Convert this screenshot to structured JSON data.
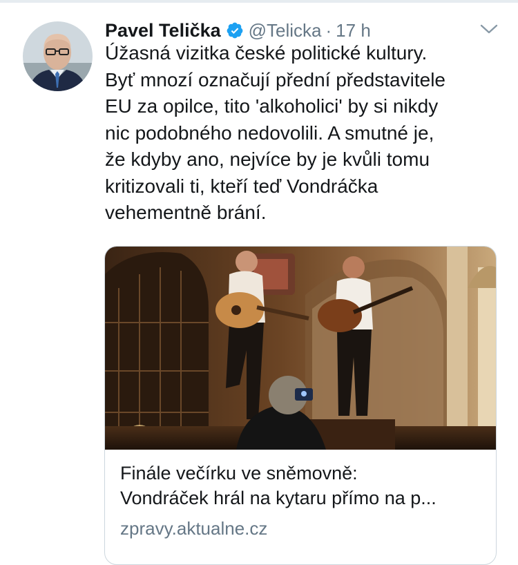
{
  "tweet": {
    "author_name": "Pavel Telička",
    "handle": "@Telicka",
    "separator": "·",
    "time": "17 h",
    "text_lines": [
      "Úžasná vizitka české politické kultury.",
      "Byť mnozí označují přední představitele",
      "EU za opilce, tito 'alkoholici' by si nikdy",
      "nic podobného nedovolili. A smutné je,",
      "že kdyby ano, nejvíce by je kvůli tomu",
      "kritizovali ti, kteří teď Vondráčka",
      "vehementně brání."
    ]
  },
  "card": {
    "title_lines": [
      "Finále večírku ve sněmovně:",
      "Vondráček hrál na kytaru přímo na p..."
    ],
    "domain": "zpravy.aktualne.cz"
  },
  "icons": {
    "verified": "verified-badge-icon",
    "chevron": "chevron-down-icon"
  },
  "colors": {
    "verified": "#1da1f2",
    "secondary_text": "#657786",
    "primary_text": "#14171a",
    "border": "#ccd6dd"
  }
}
